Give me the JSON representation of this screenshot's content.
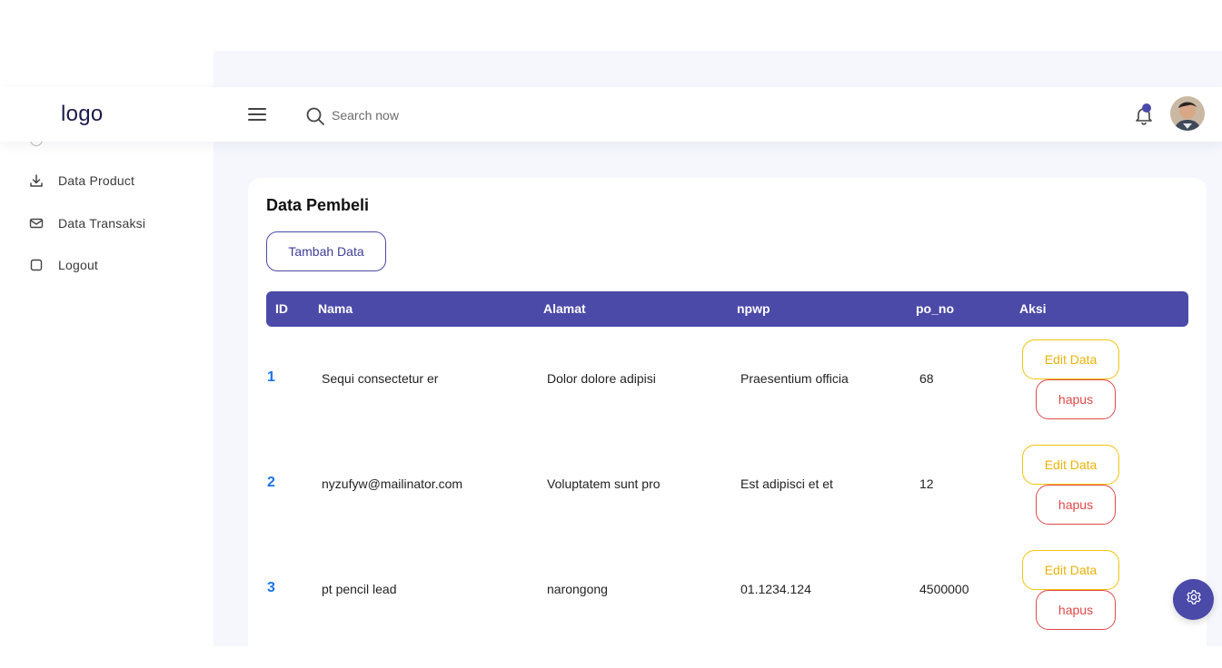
{
  "brand": {
    "logo_text": "logo"
  },
  "search": {
    "placeholder": "Search now"
  },
  "sidebar": {
    "items": [
      {
        "label": "Data Product",
        "icon": "download-icon"
      },
      {
        "label": "Data Transaksi",
        "icon": "mail-icon"
      },
      {
        "label": "Logout",
        "icon": "square-icon"
      }
    ]
  },
  "page": {
    "title": "Data Pembeli",
    "add_button": "Tambah Data"
  },
  "table": {
    "headers": [
      "ID",
      "Nama",
      "Alamat",
      "npwp",
      "po_no",
      "Aksi"
    ],
    "rows": [
      {
        "id": "1",
        "nama": "Sequi consectetur er",
        "alamat": "Dolor dolore adipisi",
        "npwp": "Praesentium officia",
        "po_no": "68"
      },
      {
        "id": "2",
        "nama": "nyzufyw@mailinator.com",
        "alamat": "Voluptatem sunt pro",
        "npwp": "Est adipisci et et",
        "po_no": "12"
      },
      {
        "id": "3",
        "nama": "pt pencil lead",
        "alamat": "narongong",
        "npwp": "01.1234.124",
        "po_no": "4500000"
      }
    ],
    "edit_label": "Edit Data",
    "delete_label": "hapus"
  },
  "colors": {
    "accent": "#4b4aa8",
    "edit": "#eab308",
    "delete": "#e04848",
    "id_link": "#1a73e8"
  }
}
